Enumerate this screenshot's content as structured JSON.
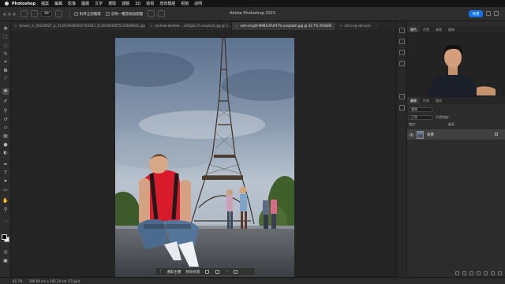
{
  "menubar": {
    "app": "Photoshop",
    "items": [
      "檔案",
      "編輯",
      "影像",
      "圖層",
      "文字",
      "選取",
      "濾鏡",
      "3D",
      "檢視",
      "增效模組",
      "視窗",
      "說明"
    ]
  },
  "window": {
    "title": "Adobe Photoshop 2023"
  },
  "options": {
    "size_value": "48",
    "check1_label": "對齊全部圖層",
    "check2_label": "忽略一覆蓋縮放圖層",
    "share_label": "共用"
  },
  "tabs": [
    {
      "label": "taiwan_rc_20230627_p_3134190449042704303_313419044055159040642.jpg",
      "active": false
    },
    {
      "label": "andrew-kambel-...x92Ig1LvY-unsplash.jpg @ 2...",
      "active": false
    },
    {
      "label": "sam-knight-N981UFUhF7U-unsplash.jpg @ 42.7% (RGB/8)",
      "active": true
    },
    {
      "label": "chris-vp-skin-pro",
      "active": false
    }
  ],
  "context_bar": {
    "select_subject": "選取主體",
    "remove_bg": "移除背景",
    "more": "···"
  },
  "status": {
    "zoom": "42.7%",
    "doc_info": "106.68 cm x 142.24 cm (72 ppi)"
  },
  "panels": {
    "top_tabs": [
      "顏色",
      "色票",
      "漸層",
      "圖樣"
    ],
    "layer_tabs": [
      "圖層",
      "色版",
      "路徑"
    ],
    "search_placeholder": "種類",
    "blend_mode": "正常",
    "opacity_label": "不透明度:",
    "lock_label": "鎖定:",
    "fill_label": "填滿:",
    "layer_name": "背景"
  },
  "colors": {
    "accent": "#1473e6",
    "shirt": "#d81a2b"
  }
}
